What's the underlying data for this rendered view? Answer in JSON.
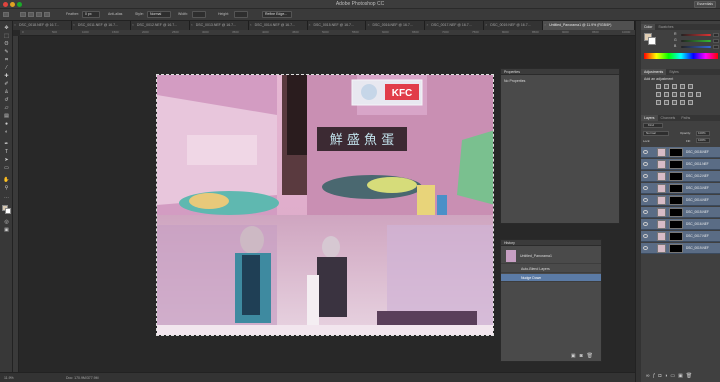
{
  "window": {
    "title": "Adobe Photoshop CC",
    "workspace": "Essentials"
  },
  "options": {
    "feather_label": "Feather:",
    "feather_value": "0 px",
    "antialias_label": "Anti-alias",
    "style_label": "Style:",
    "style_value": "Normal",
    "width_label": "Width:",
    "height_label": "Height:",
    "refine_label": "Refine Edge..."
  },
  "tabs": [
    {
      "label": "DSC_0018.NEF @ 16.7...",
      "active": false
    },
    {
      "label": "DSC_0011.NEF @ 16.7...",
      "active": false
    },
    {
      "label": "DSC_0012.NEF @ 16.7...",
      "active": false
    },
    {
      "label": "DSC_0013.NEF @ 16.7...",
      "active": false
    },
    {
      "label": "DSC_0014.NEF @ 16.7...",
      "active": false
    },
    {
      "label": "DSC_0015.NEF @ 16.7...",
      "active": false
    },
    {
      "label": "DSC_0016.NEF @ 16.7...",
      "active": false
    },
    {
      "label": "DSC_0017.NEF @ 16.7...",
      "active": false
    },
    {
      "label": "DSC_0019.NEF @ 16.7...",
      "active": false
    },
    {
      "label": "Untitled_Panorama1 @ 11.9% (RGB/8*)",
      "active": true
    }
  ],
  "ruler_ticks": [
    "0",
    "500",
    "1000",
    "1500",
    "2000",
    "2500",
    "3000",
    "3500",
    "4000",
    "4500",
    "5000",
    "5500",
    "6000",
    "6500",
    "7000",
    "7500",
    "8000",
    "8500",
    "9000",
    "9500",
    "10000"
  ],
  "document": {
    "sign_kfc": "KFC",
    "sign_chinese": "鮮 盛 魚 蛋"
  },
  "properties_panel": {
    "title": "Properties",
    "empty_text": "No Properties"
  },
  "history_panel": {
    "title": "History",
    "items": [
      {
        "label": "Untitled_Panorama1",
        "selected": false
      },
      {
        "label": "Auto-Blend Layers",
        "selected": false
      },
      {
        "label": "Nudge Down",
        "selected": true
      }
    ]
  },
  "color_panel": {
    "tabs": [
      "Color",
      "Swatches"
    ],
    "sliders": [
      {
        "label": "R",
        "value": "",
        "color": "#d33"
      },
      {
        "label": "G",
        "value": "",
        "color": "#3b3"
      },
      {
        "label": "B",
        "value": "",
        "color": "#36d"
      }
    ]
  },
  "adjustments_panel": {
    "tabs": [
      "Adjustments",
      "Styles"
    ],
    "hint": "Add an adjustment"
  },
  "layers_panel": {
    "tabs": [
      "Layers",
      "Channels",
      "Paths"
    ],
    "kind_label": "Kind",
    "blend_mode": "Normal",
    "opacity_label": "Opacity:",
    "opacity_value": "100%",
    "lock_label": "Lock:",
    "fill_label": "Fill:",
    "fill_value": "100%",
    "layers": [
      "DSC_0018.NEF",
      "DSC_0011.NEF",
      "DSC_0012.NEF",
      "DSC_0013.NEF",
      "DSC_0014.NEF",
      "DSC_0015.NEF",
      "DSC_0016.NEF",
      "DSC_0017.NEF",
      "DSC_0019.NEF"
    ]
  },
  "status": {
    "zoom": "11.9%",
    "doc": "Doc: 170.9M/377.9M"
  },
  "colors": {
    "accent": "#5b7ba6",
    "panel_bg": "#4a4a4a",
    "canvas_bg": "#282828"
  }
}
